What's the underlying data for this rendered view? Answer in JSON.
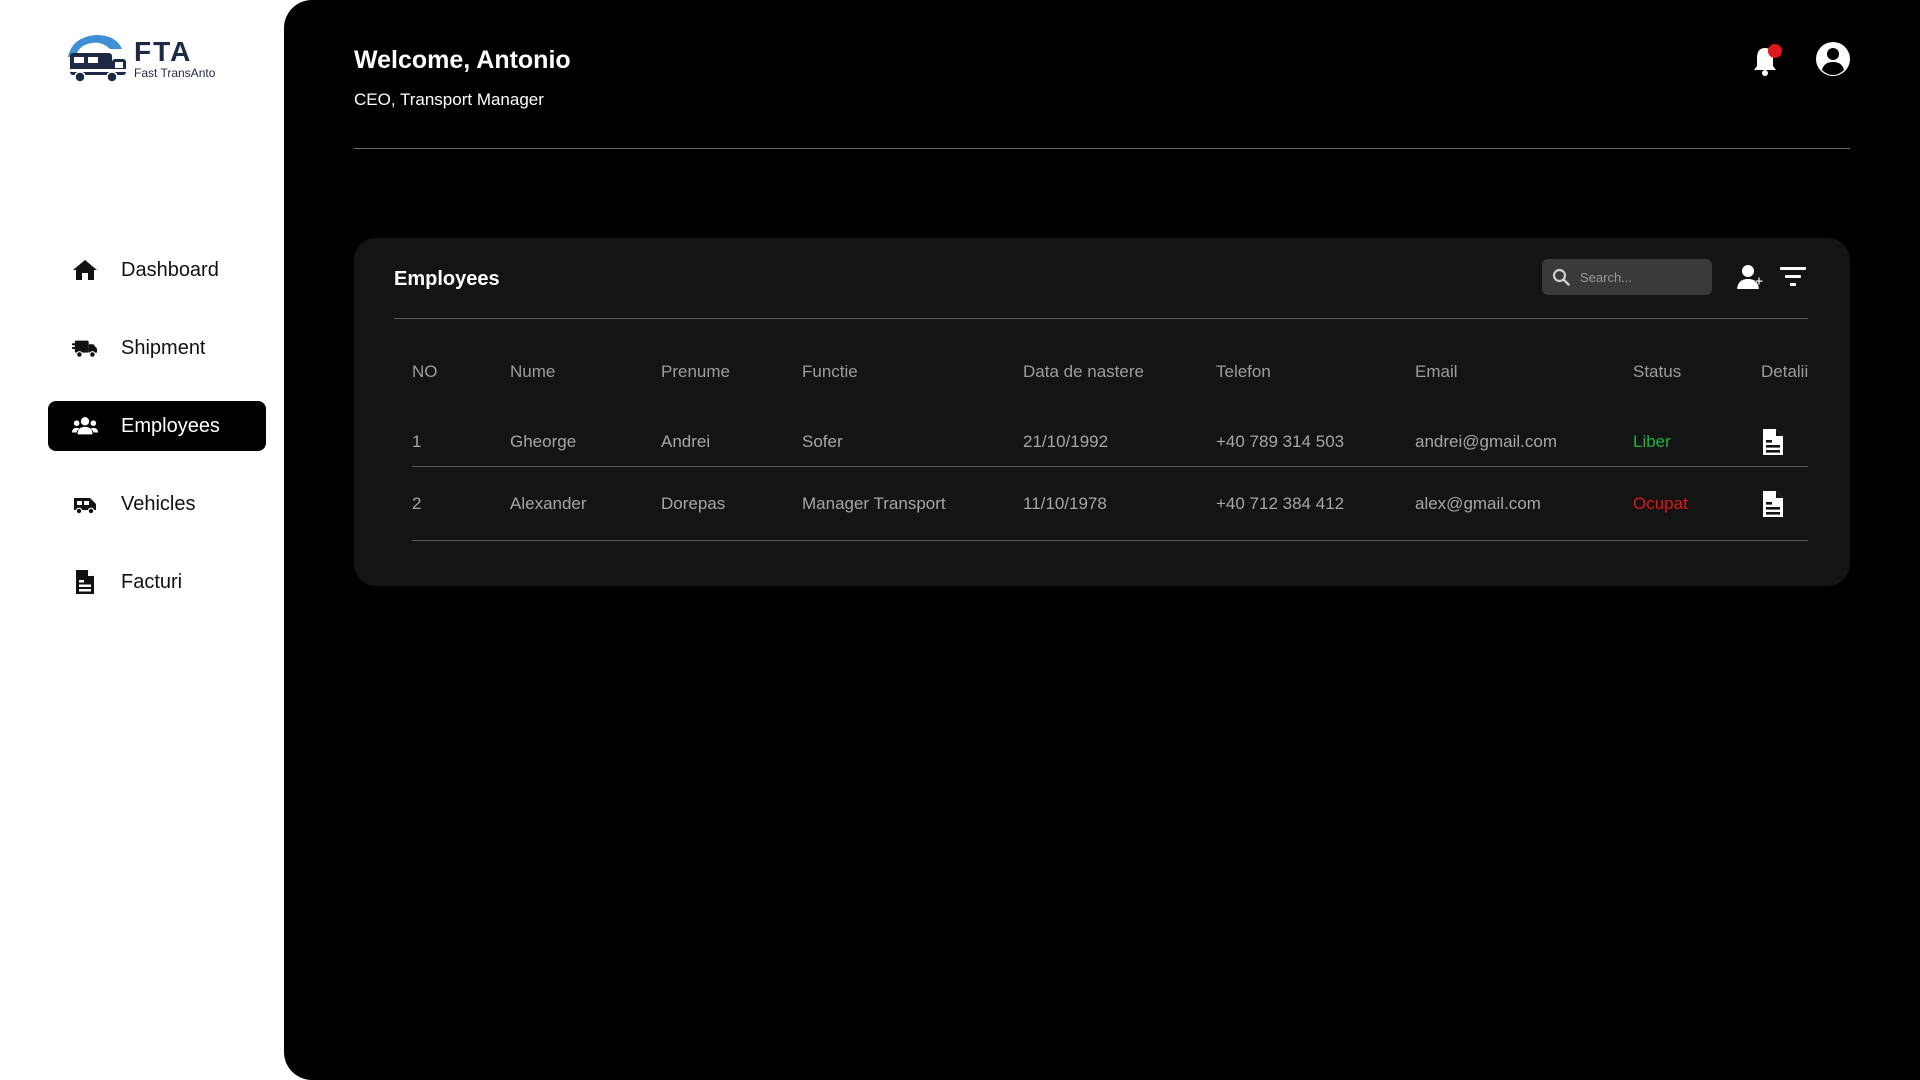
{
  "logo": {
    "abbr": "FTA",
    "name": "Fast TransAnto"
  },
  "sidebar": {
    "items": [
      {
        "label": "Dashboard",
        "icon": "home-icon",
        "active": false
      },
      {
        "label": "Shipment",
        "icon": "truck-icon",
        "active": false
      },
      {
        "label": "Employees",
        "icon": "users-icon",
        "active": true
      },
      {
        "label": "Vehicles",
        "icon": "van-icon",
        "active": false
      },
      {
        "label": "Facturi",
        "icon": "invoice-icon",
        "active": false
      }
    ]
  },
  "header": {
    "welcome": "Welcome, Antonio",
    "role": "CEO, Transport Manager",
    "notification_icon": "bell-icon",
    "notification_color": "#e0181b",
    "user_icon": "user-circle-icon"
  },
  "employees": {
    "title": "Employees",
    "search_placeholder": "Search...",
    "columns": [
      "NO",
      "Nume",
      "Prenume",
      "Functie",
      "Data de nastere",
      "Telefon",
      "Email",
      "Status",
      "Detalii"
    ],
    "rows": [
      {
        "no": "1",
        "nume": "Gheorge",
        "prenume": "Andrei",
        "functie": "Sofer",
        "data_nastere": "21/10/1992",
        "telefon": "+40 789 314 503",
        "email": "andrei@gmail.com",
        "status": "Liber"
      },
      {
        "no": "2",
        "nume": "Alexander",
        "prenume": "Dorepas",
        "functie": "Manager Transport",
        "data_nastere": "11/10/1978",
        "telefon": "+40 712 384 412",
        "email": "alex@gmail.com",
        "status": "Ocupat"
      }
    ],
    "status_colors": {
      "Liber": "#1db33c",
      "Ocupat": "#e01818"
    }
  }
}
